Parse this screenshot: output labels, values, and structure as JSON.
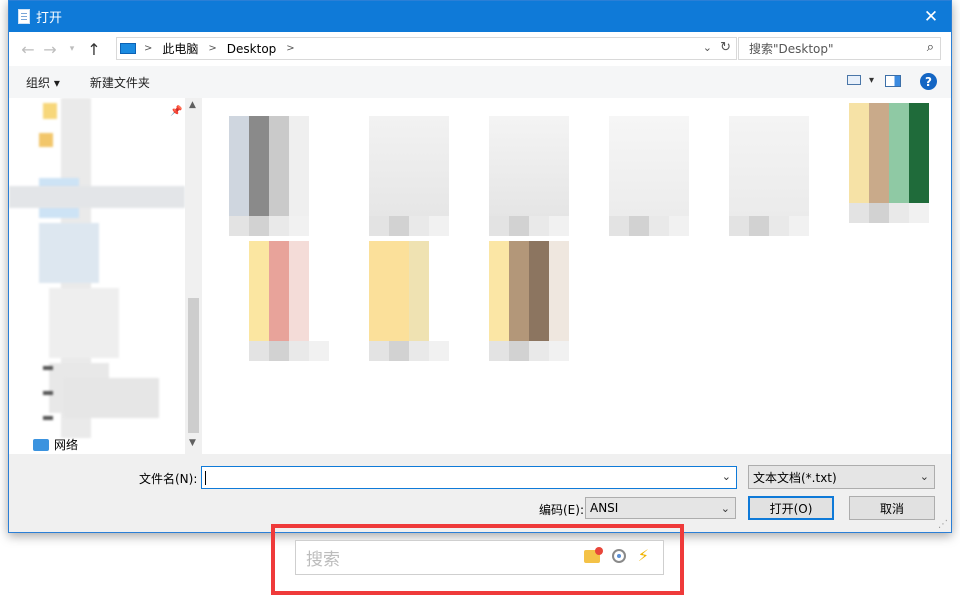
{
  "window": {
    "title": "打开"
  },
  "address": {
    "crumbs": [
      "此电脑",
      "Desktop"
    ]
  },
  "search": {
    "placeholder": "搜索\"Desktop\""
  },
  "toolbar": {
    "organize_label": "组织 ▾",
    "new_folder_label": "新建文件夹"
  },
  "navpane": {
    "network_label": "网络"
  },
  "bottom": {
    "filename_label": "文件名(N):",
    "filename_value": "",
    "filetype_value": "文本文档(*.txt)",
    "encoding_label": "编码(E):",
    "encoding_value": "ANSI",
    "open_label": "打开(O)",
    "cancel_label": "取消"
  },
  "external_search": {
    "placeholder": "搜索"
  },
  "colors": {
    "accent": "#0f7ad8",
    "highlight": "#ef3a3a"
  },
  "icons": [
    "notepad-icon",
    "close-icon",
    "back-arrow-icon",
    "forward-arrow-icon",
    "up-arrow-icon",
    "computer-icon",
    "refresh-icon",
    "search-icon",
    "view-icon",
    "preview-pane-icon",
    "help-icon",
    "pin-icon",
    "network-icon",
    "folder-icon",
    "media-icon",
    "lightning-icon"
  ]
}
